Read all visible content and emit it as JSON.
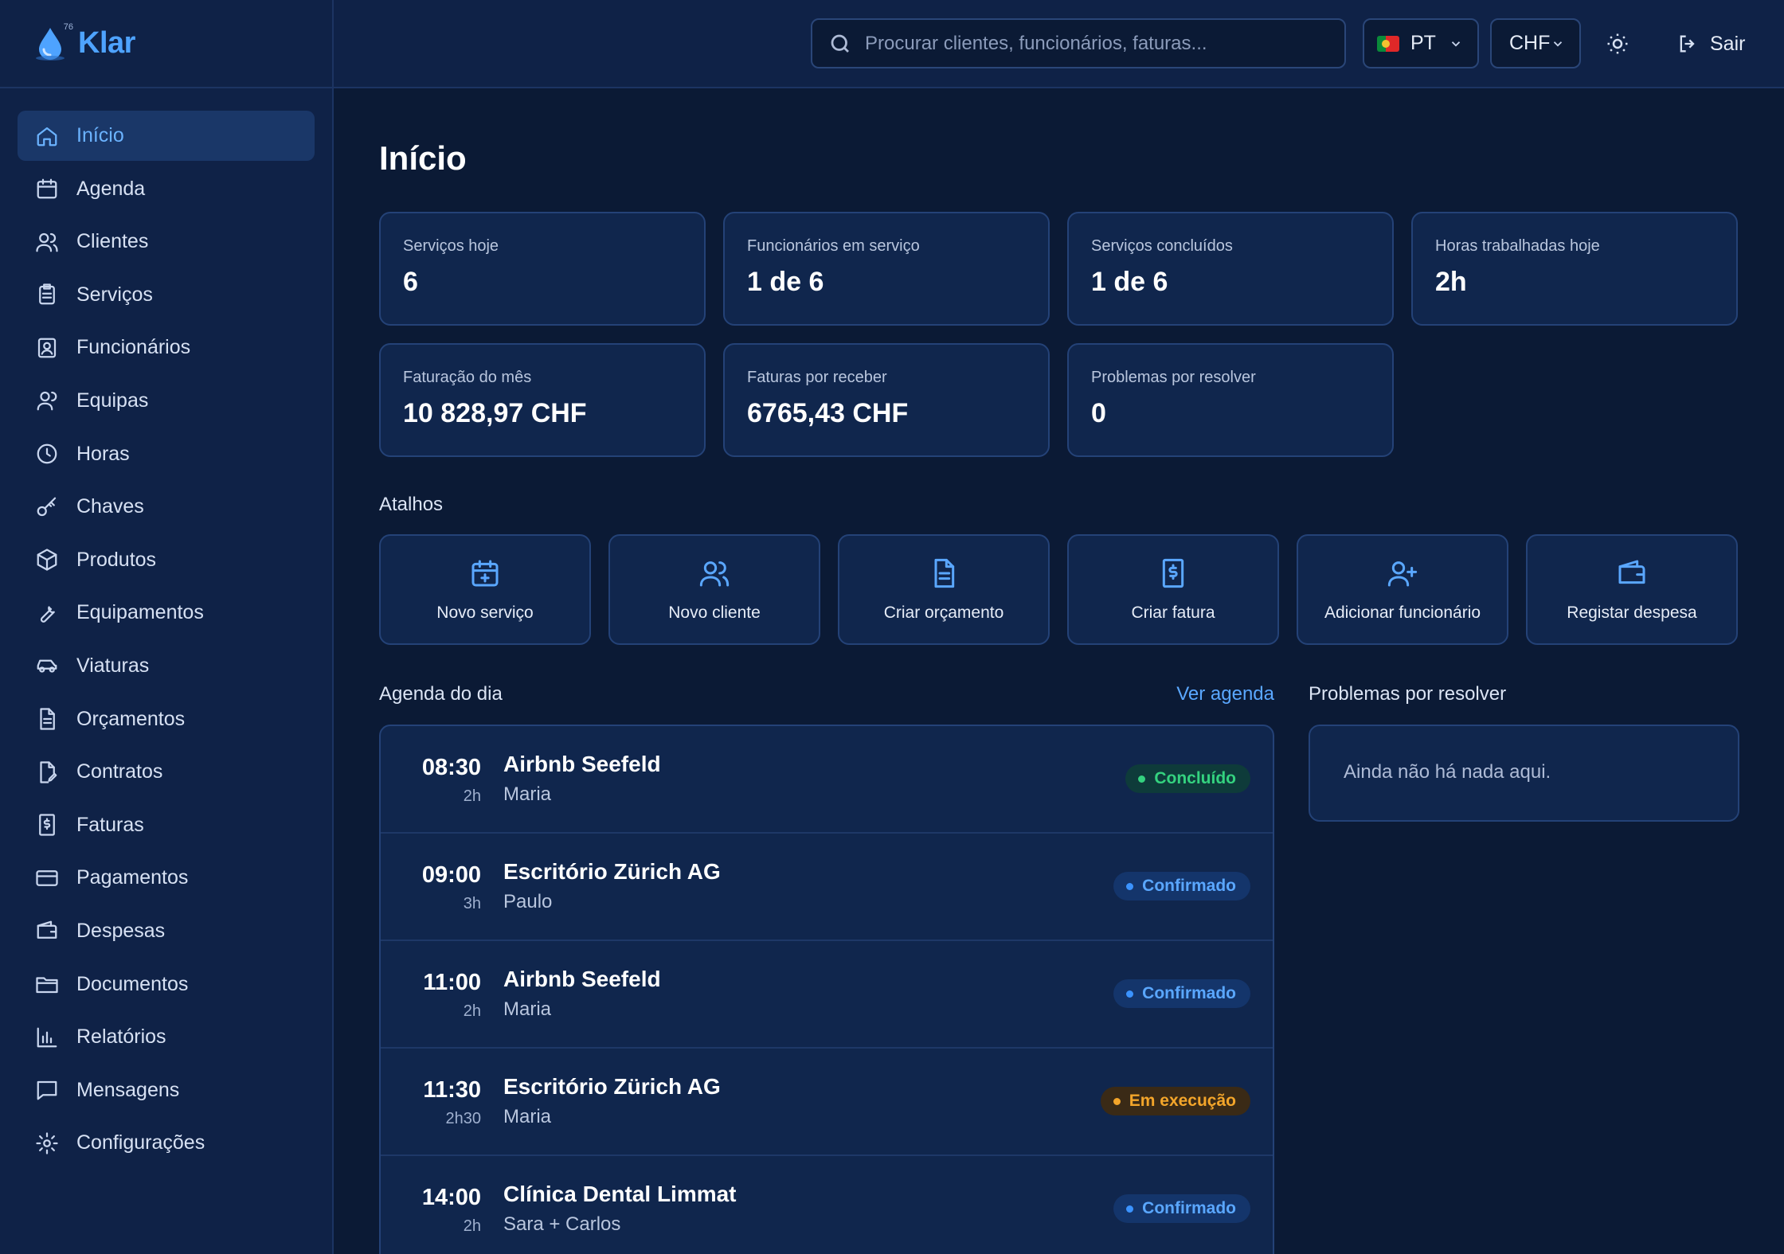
{
  "brand": {
    "name": "Klar",
    "logo_badge": "76"
  },
  "nav": [
    {
      "label": "Início",
      "icon": "home-icon",
      "active": true
    },
    {
      "label": "Agenda",
      "icon": "calendar-icon"
    },
    {
      "label": "Clientes",
      "icon": "users-icon"
    },
    {
      "label": "Serviços",
      "icon": "clipboard-icon"
    },
    {
      "label": "Funcionários",
      "icon": "id-badge-icon"
    },
    {
      "label": "Equipas",
      "icon": "team-icon"
    },
    {
      "label": "Horas",
      "icon": "clock-icon"
    },
    {
      "label": "Chaves",
      "icon": "key-icon"
    },
    {
      "label": "Produtos",
      "icon": "box-icon"
    },
    {
      "label": "Equipamentos",
      "icon": "wrench-icon"
    },
    {
      "label": "Viaturas",
      "icon": "car-icon"
    },
    {
      "label": "Orçamentos",
      "icon": "document-icon"
    },
    {
      "label": "Contratos",
      "icon": "contract-icon"
    },
    {
      "label": "Faturas",
      "icon": "invoice-icon"
    },
    {
      "label": "Pagamentos",
      "icon": "credit-card-icon"
    },
    {
      "label": "Despesas",
      "icon": "wallet-icon"
    },
    {
      "label": "Documentos",
      "icon": "folder-icon"
    },
    {
      "label": "Relatórios",
      "icon": "bar-chart-icon"
    },
    {
      "label": "Mensagens",
      "icon": "message-icon"
    },
    {
      "label": "Configurações",
      "icon": "gear-icon"
    }
  ],
  "topbar": {
    "search_placeholder": "Procurar clientes, funcionários, faturas...",
    "language": "PT",
    "currency": "CHF",
    "logout_label": "Sair"
  },
  "page": {
    "title": "Início"
  },
  "stats": [
    {
      "label": "Serviços hoje",
      "value": "6"
    },
    {
      "label": "Funcionários em serviço",
      "value": "1 de 6"
    },
    {
      "label": "Serviços concluídos",
      "value": "1 de 6"
    },
    {
      "label": "Horas trabalhadas hoje",
      "value": "2h"
    },
    {
      "label": "Faturação do mês",
      "value": "10 828,97 CHF"
    },
    {
      "label": "Faturas por receber",
      "value": "6765,43 CHF"
    },
    {
      "label": "Problemas por resolver",
      "value": "0"
    }
  ],
  "shortcuts_title": "Atalhos",
  "shortcuts": [
    {
      "label": "Novo serviço",
      "icon": "calendar-plus-icon"
    },
    {
      "label": "Novo cliente",
      "icon": "users-icon"
    },
    {
      "label": "Criar orçamento",
      "icon": "document-icon"
    },
    {
      "label": "Criar fatura",
      "icon": "invoice-icon"
    },
    {
      "label": "Adicionar funcionário",
      "icon": "user-plus-icon"
    },
    {
      "label": "Registar despesa",
      "icon": "wallet-icon"
    }
  ],
  "agenda": {
    "title": "Agenda do dia",
    "link": "Ver agenda",
    "items": [
      {
        "time": "08:30",
        "duration": "2h",
        "client": "Airbnb Seefeld",
        "staff": "Maria",
        "status": "Concluído",
        "status_color": "#34d27f"
      },
      {
        "time": "09:00",
        "duration": "3h",
        "client": "Escritório Zürich AG",
        "staff": "Paulo",
        "status": "Confirmado",
        "status_color": "#5aa7ff"
      },
      {
        "time": "11:00",
        "duration": "2h",
        "client": "Airbnb Seefeld",
        "staff": "Maria",
        "status": "Confirmado",
        "status_color": "#5aa7ff"
      },
      {
        "time": "11:30",
        "duration": "2h30",
        "client": "Escritório Zürich AG",
        "staff": "Maria",
        "status": "Em execução",
        "status_color": "#f3a52a"
      },
      {
        "time": "14:00",
        "duration": "2h",
        "client": "Clínica Dental Limmat",
        "staff": "Sara + Carlos",
        "status": "Confirmado",
        "status_color": "#5aa7ff"
      }
    ]
  },
  "problems": {
    "title": "Problemas por resolver",
    "empty_text": "Ainda não há nada aqui."
  },
  "colors": {
    "background": "#0b1a35",
    "panel": "#10264d",
    "accent": "#5aa7ff"
  }
}
